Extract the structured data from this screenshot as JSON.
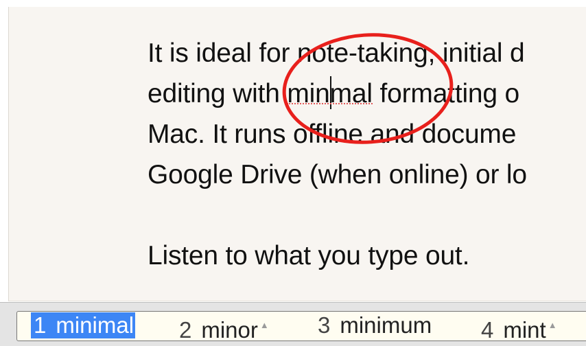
{
  "document": {
    "line1": "It is ideal for note-taking, initial d",
    "line2_before": "editing with ",
    "line2_word": "minmal",
    "line2_after": " formatting o",
    "line3": "Mac. It runs offline and docume",
    "line4": "Google Drive (when online) or lo",
    "line6": "Listen to what you type out."
  },
  "annotation": {
    "color": "#e8201c",
    "shape": "ellipse"
  },
  "suggestions": {
    "selected_color": "#3d86f5",
    "items": [
      {
        "number": "1",
        "word": "minimal",
        "selected": true,
        "has_triangle": false
      },
      {
        "number": "2",
        "word": "minor",
        "selected": false,
        "has_triangle": true
      },
      {
        "number": "3",
        "word": "minimum",
        "selected": false,
        "has_triangle": false
      },
      {
        "number": "4",
        "word": "mint",
        "selected": false,
        "has_triangle": true
      }
    ],
    "triangle_glyph": "▲"
  }
}
